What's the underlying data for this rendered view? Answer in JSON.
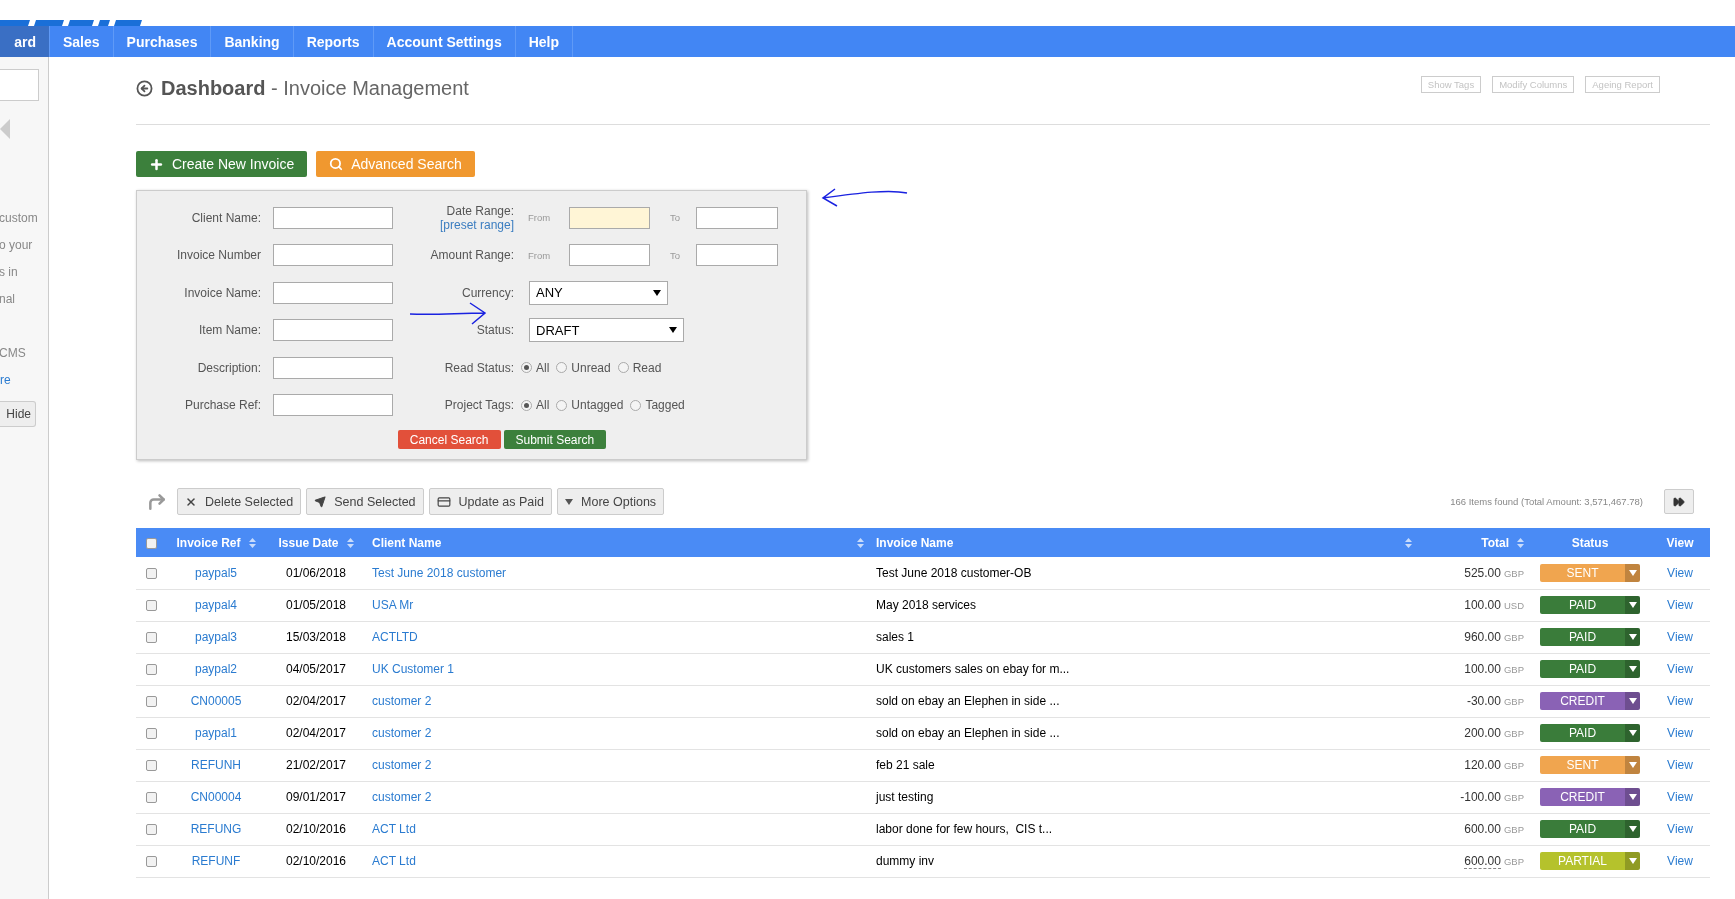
{
  "nav": {
    "items": [
      {
        "label": "ard",
        "selected": true
      },
      {
        "label": "Sales",
        "selected": false
      },
      {
        "label": "Purchases",
        "selected": false
      },
      {
        "label": "Banking",
        "selected": false
      },
      {
        "label": "Reports",
        "selected": false
      },
      {
        "label": "Account Settings",
        "selected": false
      },
      {
        "label": "Help",
        "selected": false
      }
    ]
  },
  "sidebar": {
    "paragraph_1": [
      "custom",
      "o your",
      "s in",
      "nal"
    ],
    "paragraph_2": [
      "CMS"
    ],
    "link": "re",
    "hide_button": "Hide"
  },
  "page": {
    "title": "Dashboard",
    "subtitle": "- Invoice Management",
    "top_buttons": [
      "Show Tags",
      "Modify Columns",
      "Ageing Report"
    ]
  },
  "actions": [
    {
      "label": "Create New Invoice",
      "kind": "create"
    },
    {
      "label": "Advanced Search",
      "kind": "search"
    }
  ],
  "search_panel": {
    "left_fields": [
      {
        "label": "Client Name:"
      },
      {
        "label": "Invoice Number"
      },
      {
        "label": "Invoice Name:"
      },
      {
        "label": "Item Name:"
      },
      {
        "label": "Description:"
      },
      {
        "label": "Purchase Ref:"
      }
    ],
    "right_rows": [
      {
        "kind": "range",
        "label": "Date Range:",
        "link": "[preset range]",
        "from_label": "From",
        "to_label": "To",
        "highlighted": true
      },
      {
        "kind": "range",
        "label": "Amount Range:",
        "from_label": "From",
        "to_label": "To",
        "highlighted": false
      },
      {
        "kind": "select",
        "label": "Currency:",
        "value": "ANY"
      },
      {
        "kind": "select",
        "label": "Status:",
        "value": "DRAFT"
      },
      {
        "kind": "radio",
        "label": "Read Status:",
        "options": [
          {
            "label": "All",
            "selected": true
          },
          {
            "label": "Unread",
            "selected": false
          },
          {
            "label": "Read",
            "selected": false
          }
        ]
      },
      {
        "kind": "radio",
        "label": "Project Tags:",
        "options": [
          {
            "label": "All",
            "selected": true
          },
          {
            "label": "Untagged",
            "selected": false
          },
          {
            "label": "Tagged",
            "selected": false
          }
        ]
      }
    ],
    "buttons": [
      {
        "label": "Cancel Search",
        "kind": "cancel"
      },
      {
        "label": "Submit Search",
        "kind": "submit"
      }
    ]
  },
  "toolbar": {
    "buttons": [
      {
        "label": "Delete Selected",
        "kind": "delete"
      },
      {
        "label": "Send Selected",
        "kind": "send"
      },
      {
        "label": "Update as Paid",
        "kind": "paid"
      },
      {
        "label": "More Options",
        "kind": "more"
      }
    ],
    "summary": "166 Items found (Total Amount: 3,571,467.78)"
  },
  "table": {
    "header_checked": false,
    "columns": [
      {
        "label": "Invoice Ref",
        "sortable": true
      },
      {
        "label": "Issue Date",
        "sortable": true
      },
      {
        "label": "Client Name",
        "sortable": true
      },
      {
        "label": "Invoice Name",
        "sortable": true
      },
      {
        "label": "Total",
        "sortable": true
      },
      {
        "label": "Status",
        "sortable": false
      },
      {
        "label": "View",
        "sortable": false
      }
    ],
    "rows": [
      {
        "checked": false,
        "ref": "paypal5",
        "date": "01/06/2018",
        "client": "Test June 2018 customer",
        "name": "Test June 2018 customer-OB",
        "amount": "525.00",
        "currency": "GBP",
        "amount_underlined": false,
        "status": {
          "label": "SENT",
          "color": "#f0a54f"
        },
        "view": "View"
      },
      {
        "checked": false,
        "ref": "paypal4",
        "date": "01/05/2018",
        "client": "USA Mr",
        "name": "May 2018 services",
        "amount": "100.00",
        "currency": "USD",
        "amount_underlined": false,
        "status": {
          "label": "PAID",
          "color": "#3a7c3a"
        },
        "view": "View"
      },
      {
        "checked": false,
        "ref": "paypal3",
        "date": "15/03/2018",
        "client": "ACTLTD",
        "name": "sales 1",
        "amount": "960.00",
        "currency": "GBP",
        "amount_underlined": false,
        "status": {
          "label": "PAID",
          "color": "#3a7c3a"
        },
        "view": "View"
      },
      {
        "checked": false,
        "ref": "paypal2",
        "date": "04/05/2017",
        "client": "UK Customer 1",
        "name": "UK customers sales on ebay for m...",
        "amount": "100.00",
        "currency": "GBP",
        "amount_underlined": false,
        "status": {
          "label": "PAID",
          "color": "#3a7c3a"
        },
        "view": "View"
      },
      {
        "checked": false,
        "ref": "CN00005",
        "date": "02/04/2017",
        "client": "customer 2",
        "name": "sold on ebay an Elephen in side ...",
        "amount": "-30.00",
        "currency": "GBP",
        "amount_underlined": false,
        "status": {
          "label": "CREDIT",
          "color": "#8a62b5"
        },
        "view": "View"
      },
      {
        "checked": false,
        "ref": "paypal1",
        "date": "02/04/2017",
        "client": "customer 2",
        "name": "sold on ebay an Elephen in side ...",
        "amount": "200.00",
        "currency": "GBP",
        "amount_underlined": false,
        "status": {
          "label": "PAID",
          "color": "#3a7c3a"
        },
        "view": "View"
      },
      {
        "checked": false,
        "ref": "REFUNH",
        "date": "21/02/2017",
        "client": "customer 2",
        "name": "feb 21 sale",
        "amount": "120.00",
        "currency": "GBP",
        "amount_underlined": false,
        "status": {
          "label": "SENT",
          "color": "#f0a54f"
        },
        "view": "View"
      },
      {
        "checked": false,
        "ref": "CN00004",
        "date": "09/01/2017",
        "client": "customer 2",
        "name": "just testing",
        "amount": "-100.00",
        "currency": "GBP",
        "amount_underlined": false,
        "status": {
          "label": "CREDIT",
          "color": "#8a62b5"
        },
        "view": "View"
      },
      {
        "checked": false,
        "ref": "REFUNG",
        "date": "02/10/2016",
        "client": "ACT Ltd",
        "name": "labor done for few hours,  CIS t...",
        "amount": "600.00",
        "currency": "GBP",
        "amount_underlined": false,
        "status": {
          "label": "PAID",
          "color": "#3a7c3a"
        },
        "view": "View"
      },
      {
        "checked": false,
        "ref": "REFUNF",
        "date": "02/10/2016",
        "client": "ACT Ltd",
        "name": "dummy inv",
        "amount": "600.00",
        "currency": "GBP",
        "amount_underlined": true,
        "status": {
          "label": "PARTIAL",
          "color": "#b5c22c"
        },
        "view": "View"
      }
    ]
  }
}
